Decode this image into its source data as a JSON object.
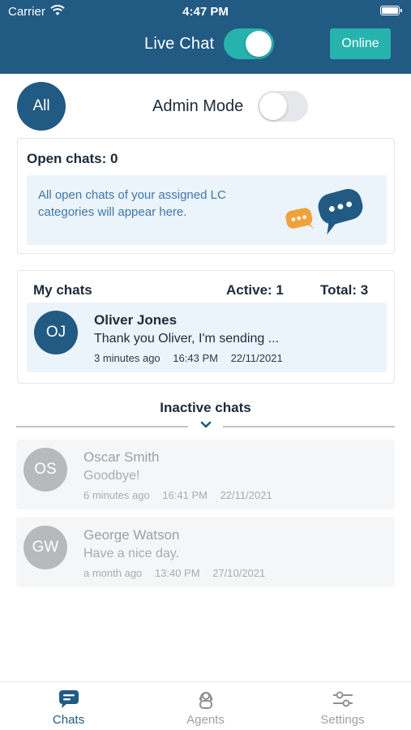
{
  "status_bar": {
    "carrier": "Carrier",
    "time": "4:47 PM"
  },
  "header": {
    "live_chat_label": "Live Chat",
    "live_chat_enabled": true,
    "online_label": "Online"
  },
  "filter": {
    "all_label": "All",
    "admin_mode_label": "Admin Mode",
    "admin_mode_enabled": false
  },
  "open_chats": {
    "title": "Open chats: 0",
    "empty_message": "All open chats of your assigned LC categories will appear here."
  },
  "my_chats": {
    "title": "My chats",
    "active": "Active: 1",
    "total": "Total: 3",
    "items": [
      {
        "initials": "OJ",
        "name": "Oliver Jones",
        "message": "Thank you Oliver, I'm sending ...",
        "ago": "3 minutes ago",
        "time": "16:43 PM",
        "date": "22/11/2021"
      }
    ]
  },
  "inactive_chats": {
    "title": "Inactive chats",
    "items": [
      {
        "initials": "OS",
        "name": "Oscar Smith",
        "message": "Goodbye!",
        "ago": "6 minutes ago",
        "time": "16:41 PM",
        "date": "22/11/2021"
      },
      {
        "initials": "GW",
        "name": "George Watson",
        "message": "Have a nice day.",
        "ago": "a month ago",
        "time": "13:40 PM",
        "date": "27/10/2021"
      }
    ]
  },
  "tabbar": {
    "tabs": [
      {
        "label": "Chats",
        "icon": "chat-icon",
        "selected": true
      },
      {
        "label": "Agents",
        "icon": "agent-icon",
        "selected": false
      },
      {
        "label": "Settings",
        "icon": "sliders-icon",
        "selected": false
      }
    ]
  },
  "colors": {
    "header": "#215a83",
    "accent": "#26b3ae",
    "info_bg": "#ebf3fb",
    "bubble_orange": "#f0a23a"
  }
}
